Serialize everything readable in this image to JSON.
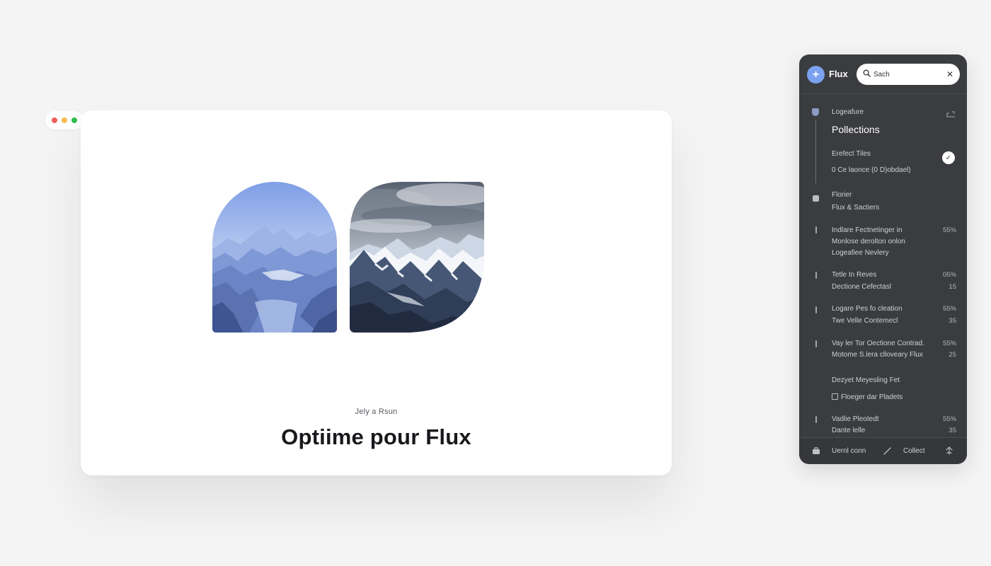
{
  "colors": {
    "page_bg": "#f4f4f5",
    "card_bg": "#ffffff",
    "panel_bg": "#3b3c3f",
    "accent": "#7aa2ee",
    "traffic_red": "#ee5f5b",
    "traffic_yellow": "#f5bd4f",
    "traffic_green": "#2fbf4f"
  },
  "window": {
    "traffic_lights": [
      "close",
      "minimize",
      "maximize"
    ]
  },
  "hero": {
    "subtitle": "Jely a Rsun",
    "title": "Optiime pour Flux",
    "images": [
      "misty-blue-mountains",
      "snowy-peaks-under-clouds"
    ]
  },
  "panel": {
    "brand_icon": "+",
    "brand": "Flux",
    "search": {
      "value": "Sach",
      "clear_icon": "✕"
    },
    "header_label": "Logeafure",
    "header_title": "Pollections",
    "sections": [
      {
        "line1": "Erefect Tiles",
        "line2": "0 Ce laonce (0 D)obdael)"
      },
      {
        "line1": "Florier",
        "line2": "Flux & Sactiers"
      },
      {
        "line1": "Indlare Fectnetinger in",
        "line2": "Monlose derolton onlon",
        "line3": "Logeafiee Nevlery",
        "value": "55%"
      },
      {
        "line1": "Tetle In Reves",
        "line2": "Dectione Cefectasl",
        "value1": "05%",
        "value2": "15"
      },
      {
        "line1": "Logare Pes fo cleation",
        "line2": "Twe Velle Contemecl",
        "value1": "55%",
        "value2": "35"
      },
      {
        "line1": "Vay ler Tor Oectione Contrad.",
        "line2": "Motome S.lera clloveary Flux",
        "value1": "55%",
        "value2": "25"
      },
      {
        "line1": "Dezyet Meyesling Fet",
        "line2": "Floeger dar Pladets"
      },
      {
        "line1": "Vadlie Pleotedt",
        "line2": "Dante lelle",
        "value1": "55%",
        "value2": "35"
      }
    ],
    "footer": {
      "item1": "Uernl conn",
      "item2": "Collect"
    }
  }
}
